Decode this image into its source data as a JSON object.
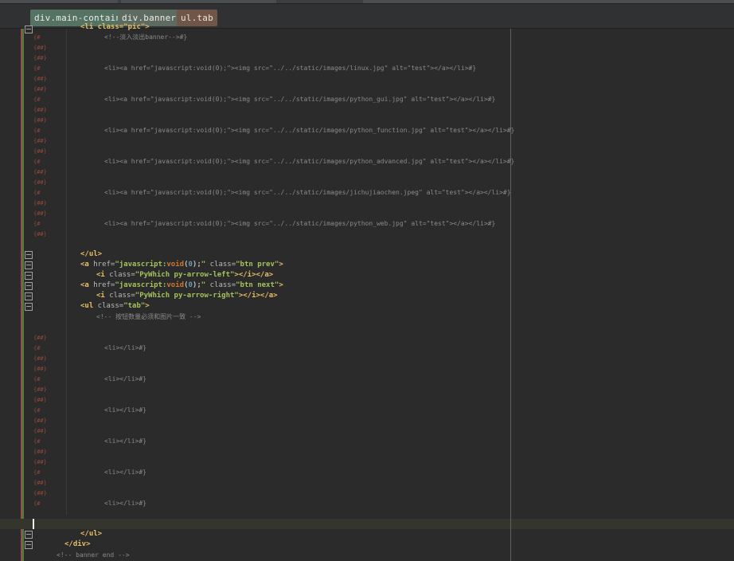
{
  "breadcrumbs": [
    "div.main-contain",
    "div.banner",
    "ul.tab"
  ],
  "colors": {
    "editor_bg": "#2b2b2b",
    "breadcrumb_1": "#547362",
    "breadcrumb_2": "#5d6b61",
    "breadcrumb_3": "#6f5648",
    "tag": "#e8bf6a",
    "string": "#a5c25c",
    "keyword": "#cc7832",
    "number": "#6897bb",
    "comment": "#808080",
    "change_bar_green": "#4f7d3e",
    "change_bar_red": "#9e4d4d"
  },
  "gutter_markers": [
    "{#",
    "{##}",
    "{##}",
    "{#",
    "{##}",
    "{##}",
    "{#",
    "{##}",
    "{##}",
    "{#",
    "{##}",
    "{##}",
    "{#",
    "{##}",
    "{##}",
    "{#",
    "{##}",
    "{##}",
    "{#",
    "{##}"
  ],
  "gutter_markers_2": [
    "{##}",
    "{#",
    "{##}",
    "{##}",
    "{#",
    "{##}",
    "{##}",
    "{#",
    "{##}",
    "{##}",
    "{#",
    "{##}",
    "{##}",
    "{#",
    "{##}",
    "{##}",
    "{#"
  ],
  "code": {
    "top_line": "<li class=\"pic\">",
    "banner_comment": "<!--淡入淡出banner-->#}",
    "img_items": [
      "<li><a href=\"javascript:void(0);\"><img src=\"../../static/images/linux.jpg\" alt=\"test\"></a></li>#}",
      "<li><a href=\"javascript:void(0);\"><img src=\"../../static/images/python_gui.jpg\" alt=\"test\"></a></li>#}",
      "<li><a href=\"javascript:void(0);\"><img src=\"../../static/images/python_function.jpg\" alt=\"test\"></a></li>#}",
      "<li><a href=\"javascript:void(0);\"><img src=\"../../static/images/python_advanced.jpg\" alt=\"test\"></a></li>#}",
      "<li><a href=\"javascript:void(0);\"><img src=\"../../static/images/jichujiaochen.jpeg\" alt=\"test\"></a></li>#}",
      "<li><a href=\"javascript:void(0);\"><img src=\"../../static/images/python_web.jpg\" alt=\"test\"></a></li>#}"
    ],
    "ul_close": "</ul>",
    "prev_link": {
      "open": "<a",
      "href_attr": " href=",
      "href_q1": "\"javascript:",
      "void_kw": "void",
      "p1": "(",
      "zero": "0",
      "p2": ");",
      "href_q2": "\"",
      "class_attr": " class=",
      "class_val": "\"btn prev\"",
      "close": ">"
    },
    "prev_icon": {
      "open": "<i",
      "class_attr": " class=",
      "class_val": "\"PyWhich py-arrow-left\"",
      "close": "></i></a>"
    },
    "next_link": {
      "open": "<a",
      "href_attr": " href=",
      "href_q1": "\"javascript:",
      "void_kw": "void",
      "p1": "(",
      "zero": "0",
      "p2": ");",
      "href_q2": "\"",
      "class_attr": " class=",
      "class_val": "\"btn next\"",
      "close": ">"
    },
    "next_icon": {
      "open": "<i",
      "class_attr": " class=",
      "class_val": "\"PyWhich py-arrow-right\"",
      "close": "></i></a>"
    },
    "ul_tab": {
      "open": "<ul",
      "class_attr": " class=",
      "class_val": "\"tab\"",
      "close": ">"
    },
    "tab_comment": "<!-- 按钮数量必须和图片一致 -->",
    "tab_items": [
      "<li></li>#}",
      "<li></li>#}",
      "<li></li>#}",
      "<li></li>#}",
      "<li></li>#}",
      "<li></li>#}"
    ],
    "ul_close_2": "</ul>",
    "div_close": "</div>",
    "banner_end": "<!-- banner end -->"
  }
}
